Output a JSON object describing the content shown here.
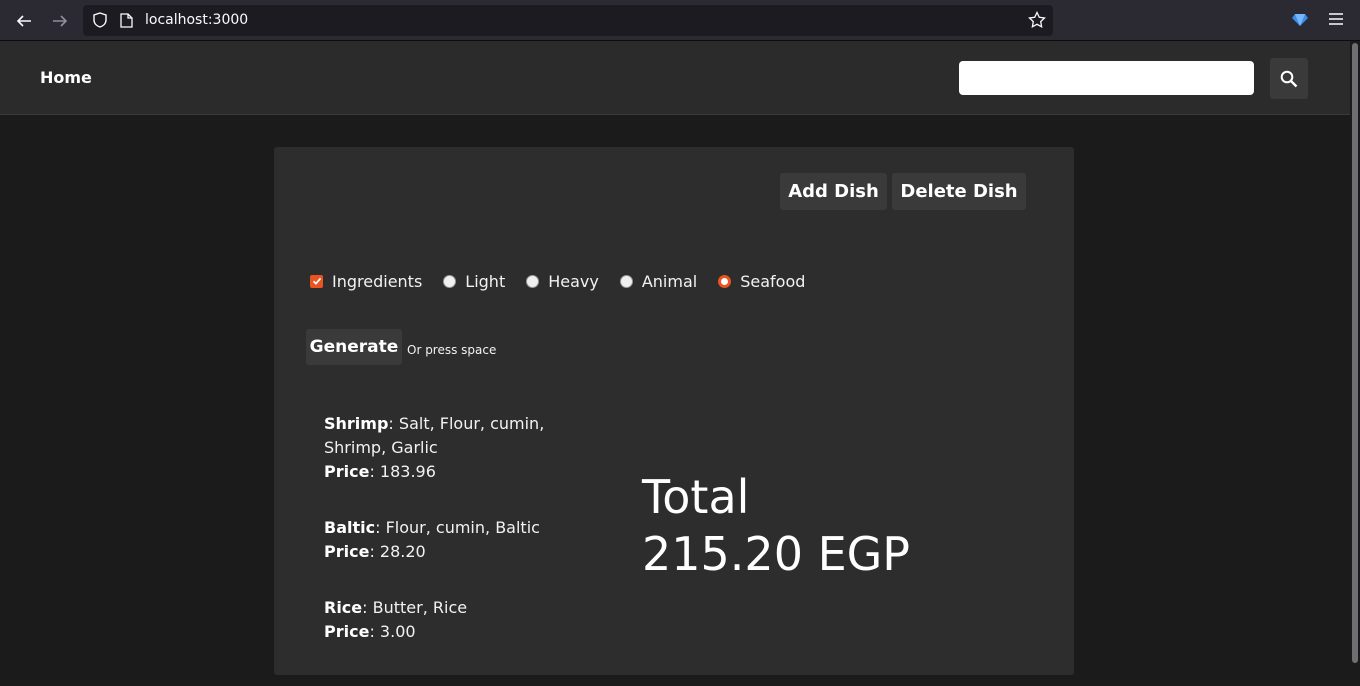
{
  "browser": {
    "url": "localhost:3000"
  },
  "navbar": {
    "home_label": "Home",
    "search_placeholder": ""
  },
  "actions": {
    "add_dish": "Add Dish",
    "delete_dish": "Delete Dish"
  },
  "filters": {
    "ingredients": {
      "label": "Ingredients",
      "checked": true
    },
    "options": [
      {
        "label": "Light",
        "checked": false
      },
      {
        "label": "Heavy",
        "checked": false
      },
      {
        "label": "Animal",
        "checked": false
      },
      {
        "label": "Seafood",
        "checked": true
      }
    ]
  },
  "generate": {
    "label": "Generate",
    "hint": "Or press space"
  },
  "dishes": [
    {
      "name": "Shrimp",
      "ingredients": "Salt, Flour, cumin, Shrimp, Garlic",
      "price_label": "Price",
      "price": "183.96"
    },
    {
      "name": "Baltic",
      "ingredients": "Flour, cumin, Baltic",
      "price_label": "Price",
      "price": "28.20"
    },
    {
      "name": "Rice",
      "ingredients": "Butter, Rice",
      "price_label": "Price",
      "price": "3.00"
    }
  ],
  "total": {
    "label": "Total",
    "value": "215.20 EGP"
  },
  "colors": {
    "accent": "#e95420",
    "background": "#1c1b1b",
    "card": "#2d2d2d"
  }
}
